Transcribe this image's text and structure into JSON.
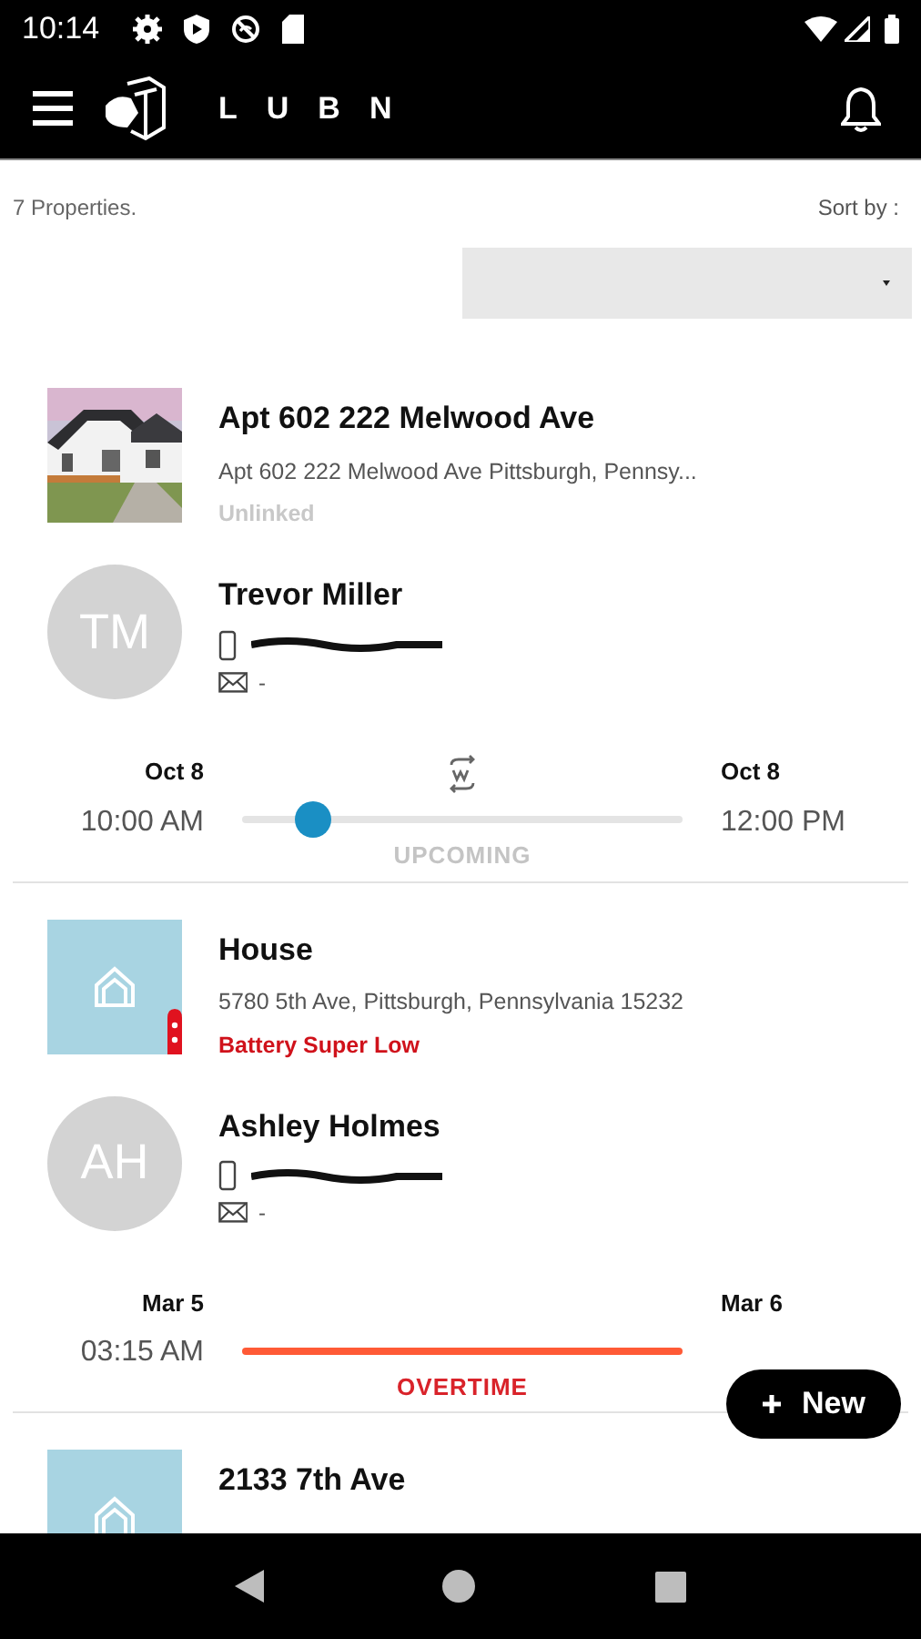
{
  "status_bar": {
    "time": "10:14"
  },
  "app_bar": {
    "brand": "LUBN"
  },
  "list_header": {
    "count": "7 Properties.",
    "sort_label": "Sort by :"
  },
  "properties": [
    {
      "title": "Apt 602 222 Melwood Ave",
      "address": "Apt 602 222 Melwood Ave Pittsburgh, Pennsy...",
      "kind": "picture",
      "status": {
        "text": "Unlinked",
        "color": "#c8c8c8"
      },
      "tenant": {
        "initials": "TM",
        "name": "Trevor Miller",
        "email": "-"
      },
      "booking": {
        "kind": "progress",
        "label": "UPCOMING",
        "color": "#c4c4c4",
        "start_date": "Oct 8",
        "start_time": "10:00 AM",
        "end_date": "Oct 8",
        "end_time": "12:00 PM",
        "level": 0.16,
        "recurring": true
      }
    },
    {
      "title": "House",
      "address": "5780 5th Ave, Pittsburgh, Pennsylvania 15232",
      "lock_badge": true,
      "status": {
        "text": "Battery Super Low",
        "color": "#d0121b"
      },
      "tenant": {
        "initials": "AH",
        "name": "Ashley Holmes",
        "email": "-"
      },
      "booking": {
        "kind": "overtime",
        "label": "OVERTIME",
        "color": "#d9232a",
        "start_date": "Mar 5",
        "start_time": "03:15 AM",
        "end_date": "Mar 6",
        "recurring": false
      }
    },
    {
      "title": "2133 7th Ave"
    }
  ],
  "fab": {
    "label": "New"
  }
}
